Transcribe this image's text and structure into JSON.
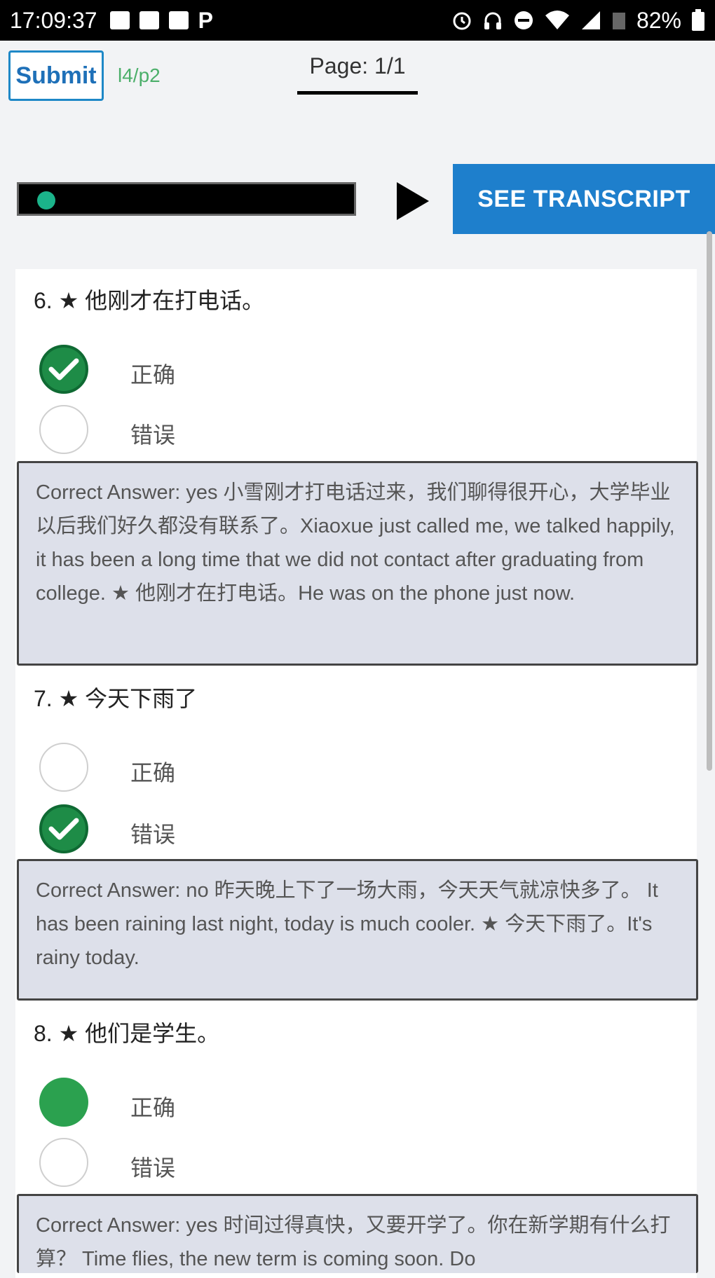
{
  "status_bar": {
    "time": "17:09:37",
    "left_icons": [
      "sim-icon",
      "image-icon",
      "cast-icon",
      "p-icon"
    ],
    "right_icons": [
      "alarm-icon",
      "headset-icon",
      "dnd-icon",
      "wifi-icon",
      "signal-icon",
      "data-icon"
    ],
    "battery": "82%"
  },
  "header": {
    "submit_label": "Submit",
    "progress": "l4/p2",
    "page_label": "Page: 1/1"
  },
  "player": {
    "transcript_label": "SEE TRANSCRIPT"
  },
  "questions": [
    {
      "title": "6. ★ 他刚才在打电话。",
      "options": [
        "正确",
        "错误"
      ],
      "answer": "Correct Answer: yes 小雪刚才打电话过来，我们聊得很开心，大学毕业以后我们好久都没有联系了。Xiaoxue just called me, we talked happily, it has been a long time that we did not contact after graduating from college. ★ 他刚才在打电话。He was on the phone just now."
    },
    {
      "title": "7. ★ 今天下雨了",
      "options": [
        "正确",
        "错误"
      ],
      "answer": "Correct Answer: no 昨天晚上下了一场大雨，今天天气就凉快多了。 It has been raining last night, today is much cooler. ★ 今天下雨了。It's rainy today."
    },
    {
      "title": "8. ★ 他们是学生。",
      "options": [
        "正确",
        "错误"
      ],
      "answer": "Correct Answer: yes 时间过得真快，又要开学了。你在新学期有什么打算？ Time flies, the new term is coming soon. Do"
    }
  ]
}
